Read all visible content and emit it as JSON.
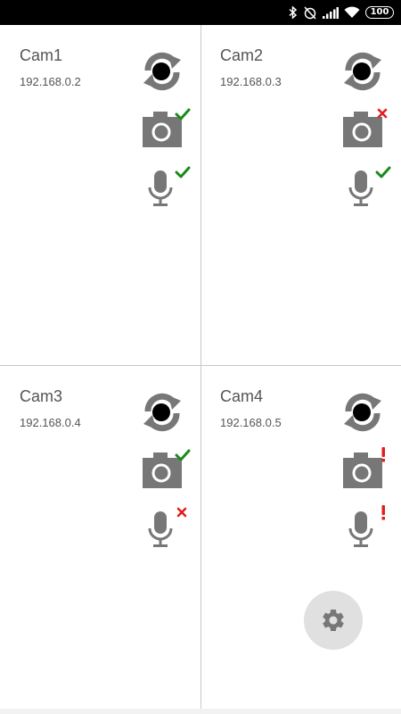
{
  "status_bar": {
    "battery": "100"
  },
  "cameras": [
    {
      "name": "Cam1",
      "ip": "192.168.0.2",
      "camera_status": "ok",
      "mic_status": "ok"
    },
    {
      "name": "Cam2",
      "ip": "192.168.0.3",
      "camera_status": "error",
      "mic_status": "ok"
    },
    {
      "name": "Cam3",
      "ip": "192.168.0.4",
      "camera_status": "ok",
      "mic_status": "error"
    },
    {
      "name": "Cam4",
      "ip": "192.168.0.5",
      "camera_status": "warning",
      "mic_status": "warning"
    }
  ],
  "colors": {
    "icon": "#777777",
    "ok": "#1a8a1a",
    "error": "#e02020",
    "warning": "#e02020",
    "fab_bg": "#e0e0e0"
  },
  "icons": {
    "refresh": "sync-record-icon",
    "camera": "camera-icon",
    "mic": "microphone-icon",
    "settings": "gear-icon"
  }
}
